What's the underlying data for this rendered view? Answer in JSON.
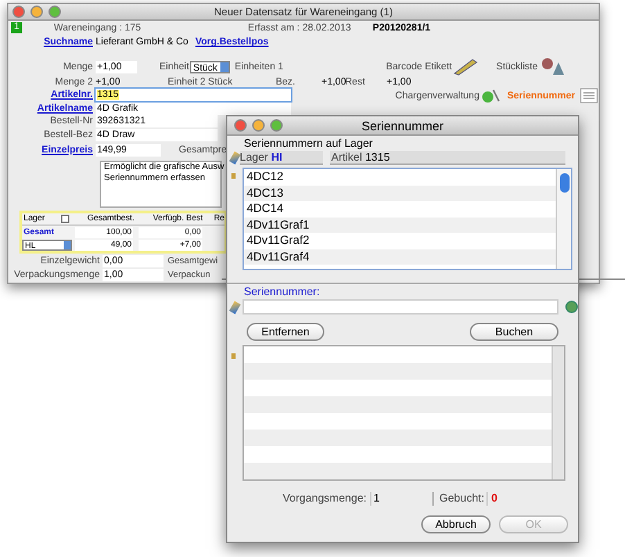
{
  "main_window": {
    "title": "Neuer Datensatz für Wareneingang (1)",
    "badge": "1",
    "info": [
      "Wareneingang : 175",
      "Erfasst am : 28.02.2013",
      "P20120281/1"
    ],
    "supplier": {
      "label": "Suchname",
      "value": "Lieferant GmbH & Co",
      "link": "Vorg.Bestellpos"
    },
    "quantity": {
      "label": "Menge",
      "value": "+1,00",
      "unit_label": "Einheit",
      "unit": "Stück",
      "extra": "Einheiten 1"
    },
    "quantity2": {
      "label": "Menge 2",
      "value": "+1,00",
      "unit2": "Einheit 2 Stück",
      "bez_label": "Bez.",
      "bez": "+1,00",
      "rest_label": "Rest",
      "rest": "+1,00"
    },
    "tools": [
      {
        "label": "Barcode Etikett",
        "kind": "barcode"
      },
      {
        "label": "Stückliste",
        "kind": "parts"
      },
      {
        "label": "Chargenverwaltung",
        "kind": "batch"
      },
      {
        "label": "Seriennummer",
        "kind": "serial"
      }
    ],
    "fields": [
      {
        "label": "Artikelnr.",
        "value": "1315",
        "link": true,
        "focused": true
      },
      {
        "label": "Artikelname",
        "value": "4D Grafik",
        "link": true,
        "focused": false
      },
      {
        "label": "Bestell-Nr",
        "value": "392631321",
        "link": false,
        "focused": false
      },
      {
        "label": "Bestell-Bez",
        "value": "4D Draw",
        "link": false,
        "focused": false
      },
      {
        "label": "Einzelpreis",
        "value": "149,99",
        "link": true,
        "focused": false,
        "side": "Gesamtpre"
      }
    ],
    "description": [
      "Ermöglicht die grafische Ausw",
      "Seriennummern erfassen"
    ],
    "stock": {
      "columns": [
        "Lager",
        "Gesamtbest.",
        "Verfügb. Best",
        "Re"
      ],
      "rows": [
        {
          "name": "Gesamt",
          "kind": "total",
          "values": [
            "100,00",
            "0,00"
          ]
        },
        {
          "name": "HL",
          "kind": "select",
          "values": [
            "49,00",
            "+7,00"
          ]
        }
      ]
    },
    "weights": [
      {
        "label": "Einzelgewicht",
        "value": "0,00",
        "side": "Gesamtgewi"
      },
      {
        "label": "Verpackungsmenge",
        "value": "1,00",
        "side": "Verpackun"
      }
    ]
  },
  "dialog": {
    "title": "Seriennummer",
    "heading": "Seriennummern auf Lager",
    "store_label": "Lager",
    "store": "HI",
    "article_label": "Artikel",
    "article": "1315",
    "stock_list": [
      "4DC12",
      "4DC13",
      "4DC14",
      "4Dv11Graf1",
      "4Dv11Graf2",
      "4Dv11Graf4"
    ],
    "serial_label": "Seriennummer:",
    "actions": [
      "Entfernen",
      "Buchen"
    ],
    "summary": [
      {
        "label": "Vorgangsmenge:",
        "value": "1",
        "kind": "normal"
      },
      {
        "label": "Gebucht:",
        "value": "0",
        "kind": "alert"
      }
    ],
    "buttons": [
      {
        "label": "Abbruch",
        "disabled": false
      },
      {
        "label": "OK",
        "disabled": true
      }
    ]
  }
}
